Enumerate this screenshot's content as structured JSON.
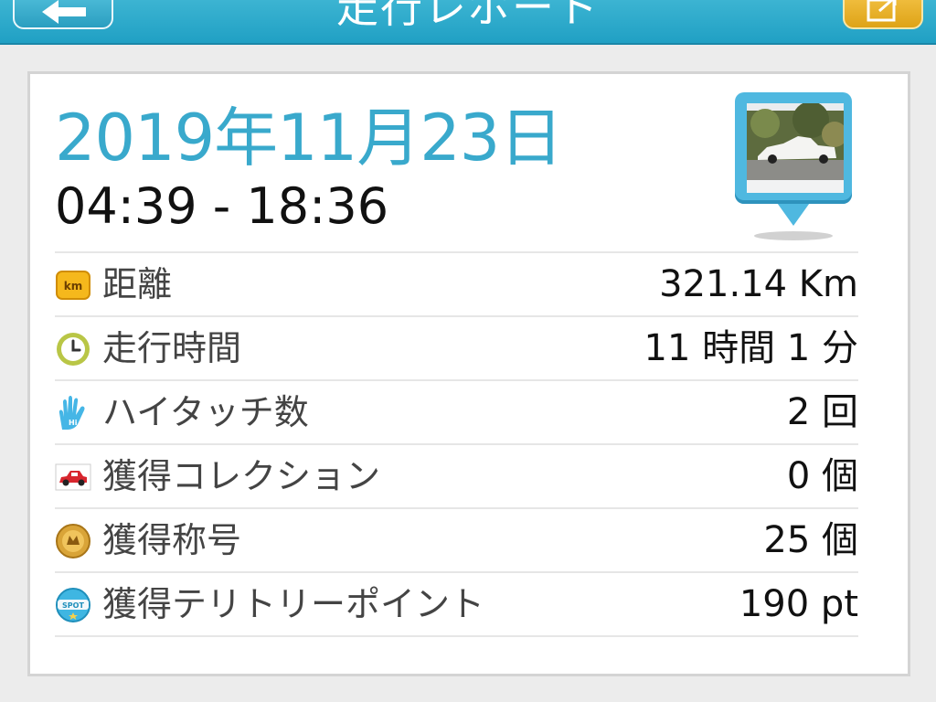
{
  "header": {
    "title": "走行レポート"
  },
  "report": {
    "date": "2019年11月23日",
    "time_range": "04:39 - 18:36"
  },
  "stats": [
    {
      "icon": "km-badge-icon",
      "label": "距離",
      "value": "321.14 Km"
    },
    {
      "icon": "clock-icon",
      "label": "走行時間",
      "value": "11 時間 1 分"
    },
    {
      "icon": "high-five-hand-icon",
      "label": "ハイタッチ数",
      "value": "2 回"
    },
    {
      "icon": "red-car-icon",
      "label": "獲得コレクション",
      "value": "0 個"
    },
    {
      "icon": "gold-medal-icon",
      "label": "獲得称号",
      "value": "25 個"
    },
    {
      "icon": "spot-badge-icon",
      "label": "獲得テリトリーポイント",
      "value": "190 pt"
    }
  ],
  "colors": {
    "header": "#20a0c4",
    "date_text": "#39a9cc",
    "marker": "#4fb8e0",
    "share_button": "#dea317"
  }
}
